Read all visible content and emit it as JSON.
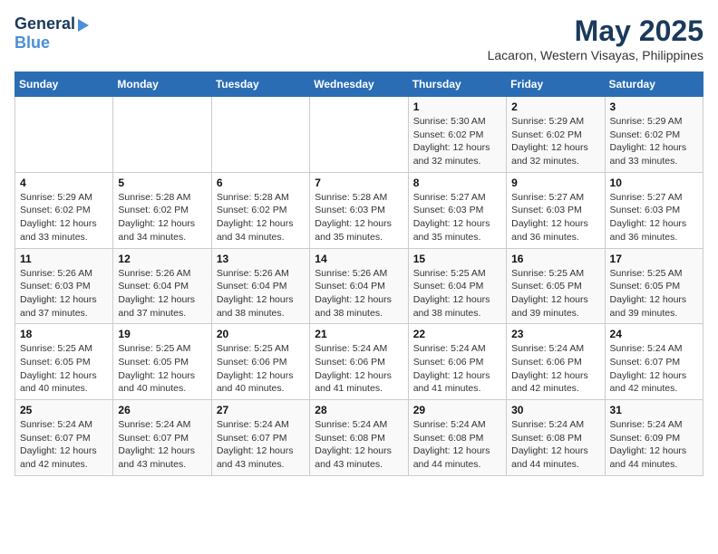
{
  "header": {
    "logo_general": "General",
    "logo_blue": "Blue",
    "title": "May 2025",
    "subtitle": "Lacaron, Western Visayas, Philippines"
  },
  "weekdays": [
    "Sunday",
    "Monday",
    "Tuesday",
    "Wednesday",
    "Thursday",
    "Friday",
    "Saturday"
  ],
  "weeks": [
    [
      {
        "day": "",
        "info": ""
      },
      {
        "day": "",
        "info": ""
      },
      {
        "day": "",
        "info": ""
      },
      {
        "day": "",
        "info": ""
      },
      {
        "day": "1",
        "info": "Sunrise: 5:30 AM\nSunset: 6:02 PM\nDaylight: 12 hours\nand 32 minutes."
      },
      {
        "day": "2",
        "info": "Sunrise: 5:29 AM\nSunset: 6:02 PM\nDaylight: 12 hours\nand 32 minutes."
      },
      {
        "day": "3",
        "info": "Sunrise: 5:29 AM\nSunset: 6:02 PM\nDaylight: 12 hours\nand 33 minutes."
      }
    ],
    [
      {
        "day": "4",
        "info": "Sunrise: 5:29 AM\nSunset: 6:02 PM\nDaylight: 12 hours\nand 33 minutes."
      },
      {
        "day": "5",
        "info": "Sunrise: 5:28 AM\nSunset: 6:02 PM\nDaylight: 12 hours\nand 34 minutes."
      },
      {
        "day": "6",
        "info": "Sunrise: 5:28 AM\nSunset: 6:02 PM\nDaylight: 12 hours\nand 34 minutes."
      },
      {
        "day": "7",
        "info": "Sunrise: 5:28 AM\nSunset: 6:03 PM\nDaylight: 12 hours\nand 35 minutes."
      },
      {
        "day": "8",
        "info": "Sunrise: 5:27 AM\nSunset: 6:03 PM\nDaylight: 12 hours\nand 35 minutes."
      },
      {
        "day": "9",
        "info": "Sunrise: 5:27 AM\nSunset: 6:03 PM\nDaylight: 12 hours\nand 36 minutes."
      },
      {
        "day": "10",
        "info": "Sunrise: 5:27 AM\nSunset: 6:03 PM\nDaylight: 12 hours\nand 36 minutes."
      }
    ],
    [
      {
        "day": "11",
        "info": "Sunrise: 5:26 AM\nSunset: 6:03 PM\nDaylight: 12 hours\nand 37 minutes."
      },
      {
        "day": "12",
        "info": "Sunrise: 5:26 AM\nSunset: 6:04 PM\nDaylight: 12 hours\nand 37 minutes."
      },
      {
        "day": "13",
        "info": "Sunrise: 5:26 AM\nSunset: 6:04 PM\nDaylight: 12 hours\nand 38 minutes."
      },
      {
        "day": "14",
        "info": "Sunrise: 5:26 AM\nSunset: 6:04 PM\nDaylight: 12 hours\nand 38 minutes."
      },
      {
        "day": "15",
        "info": "Sunrise: 5:25 AM\nSunset: 6:04 PM\nDaylight: 12 hours\nand 38 minutes."
      },
      {
        "day": "16",
        "info": "Sunrise: 5:25 AM\nSunset: 6:05 PM\nDaylight: 12 hours\nand 39 minutes."
      },
      {
        "day": "17",
        "info": "Sunrise: 5:25 AM\nSunset: 6:05 PM\nDaylight: 12 hours\nand 39 minutes."
      }
    ],
    [
      {
        "day": "18",
        "info": "Sunrise: 5:25 AM\nSunset: 6:05 PM\nDaylight: 12 hours\nand 40 minutes."
      },
      {
        "day": "19",
        "info": "Sunrise: 5:25 AM\nSunset: 6:05 PM\nDaylight: 12 hours\nand 40 minutes."
      },
      {
        "day": "20",
        "info": "Sunrise: 5:25 AM\nSunset: 6:06 PM\nDaylight: 12 hours\nand 40 minutes."
      },
      {
        "day": "21",
        "info": "Sunrise: 5:24 AM\nSunset: 6:06 PM\nDaylight: 12 hours\nand 41 minutes."
      },
      {
        "day": "22",
        "info": "Sunrise: 5:24 AM\nSunset: 6:06 PM\nDaylight: 12 hours\nand 41 minutes."
      },
      {
        "day": "23",
        "info": "Sunrise: 5:24 AM\nSunset: 6:06 PM\nDaylight: 12 hours\nand 42 minutes."
      },
      {
        "day": "24",
        "info": "Sunrise: 5:24 AM\nSunset: 6:07 PM\nDaylight: 12 hours\nand 42 minutes."
      }
    ],
    [
      {
        "day": "25",
        "info": "Sunrise: 5:24 AM\nSunset: 6:07 PM\nDaylight: 12 hours\nand 42 minutes."
      },
      {
        "day": "26",
        "info": "Sunrise: 5:24 AM\nSunset: 6:07 PM\nDaylight: 12 hours\nand 43 minutes."
      },
      {
        "day": "27",
        "info": "Sunrise: 5:24 AM\nSunset: 6:07 PM\nDaylight: 12 hours\nand 43 minutes."
      },
      {
        "day": "28",
        "info": "Sunrise: 5:24 AM\nSunset: 6:08 PM\nDaylight: 12 hours\nand 43 minutes."
      },
      {
        "day": "29",
        "info": "Sunrise: 5:24 AM\nSunset: 6:08 PM\nDaylight: 12 hours\nand 44 minutes."
      },
      {
        "day": "30",
        "info": "Sunrise: 5:24 AM\nSunset: 6:08 PM\nDaylight: 12 hours\nand 44 minutes."
      },
      {
        "day": "31",
        "info": "Sunrise: 5:24 AM\nSunset: 6:09 PM\nDaylight: 12 hours\nand 44 minutes."
      }
    ]
  ]
}
